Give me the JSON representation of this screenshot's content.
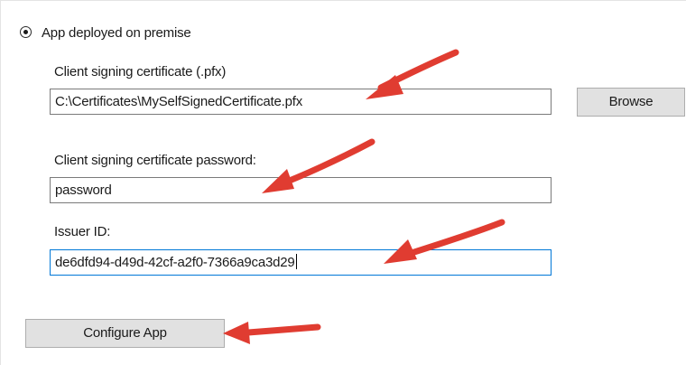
{
  "deployment": {
    "option_label": "App deployed on premise",
    "selected": true
  },
  "certificate": {
    "label": "Client signing certificate (.pfx)",
    "value": "C:\\Certificates\\MySelfSignedCertificate.pfx",
    "browse_label": "Browse"
  },
  "password": {
    "label": "Client signing certificate password:",
    "value": "password"
  },
  "issuer": {
    "label": "Issuer ID:",
    "value": "de6dfd94-d49d-42cf-a2f0-7366a9ca3d29"
  },
  "actions": {
    "configure_label": "Configure App"
  },
  "colors": {
    "annotation_arrow": "#e03c31",
    "focus_border": "#0078d7",
    "button_face": "#e1e1e1"
  }
}
